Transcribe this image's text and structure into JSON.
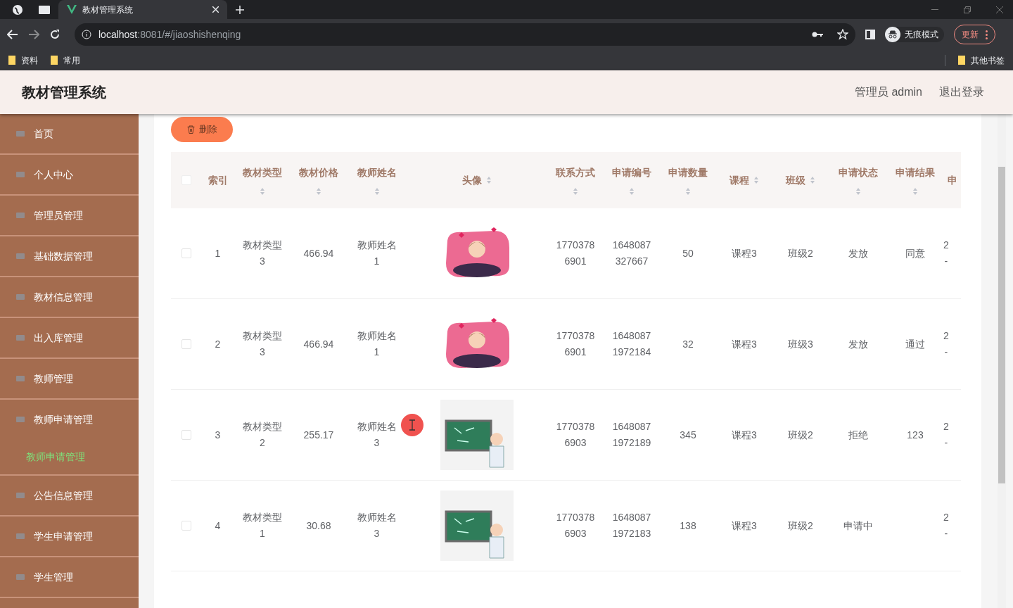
{
  "browser": {
    "tabs": [
      {
        "title": "教材管理系统",
        "selected": true
      }
    ],
    "url_host": "localhost",
    "url_path": ":8081/#/jiaoshishenqing",
    "profile": "无痕模式",
    "update_button": "更新",
    "bookmarks": [
      "资料",
      "常用"
    ],
    "other_bookmarks": "其他书签"
  },
  "header": {
    "title": "教材管理系统",
    "user": "管理员 admin",
    "logout": "退出登录"
  },
  "sidebar": {
    "items": [
      {
        "label": "首页"
      },
      {
        "label": "个人中心"
      },
      {
        "label": "管理员管理"
      },
      {
        "label": "基础数据管理"
      },
      {
        "label": "教材信息管理"
      },
      {
        "label": "出入库管理"
      },
      {
        "label": "教师管理"
      },
      {
        "label": "教师申请管理",
        "children": [
          {
            "label": "教师申请管理",
            "selected": true
          }
        ]
      },
      {
        "label": "公告信息管理"
      },
      {
        "label": "学生申请管理"
      },
      {
        "label": "学生管理"
      }
    ]
  },
  "toolbar": {
    "delete_button": "删除"
  },
  "table": {
    "select_all_checked": false,
    "columns": [
      {
        "label": "索引",
        "sortable": false
      },
      {
        "label": "教材类型",
        "sortable": true
      },
      {
        "label": "教材价格",
        "sortable": true
      },
      {
        "label": "教师姓名",
        "sortable": true
      },
      {
        "label": "头像",
        "sortable": true
      },
      {
        "label": "联系方式",
        "sortable": true
      },
      {
        "label": "申请编号",
        "sortable": true
      },
      {
        "label": "申请数量",
        "sortable": true
      },
      {
        "label": "课程",
        "sortable": true
      },
      {
        "label": "班级",
        "sortable": true
      },
      {
        "label": "申请状态",
        "sortable": true
      },
      {
        "label": "申请结果",
        "sortable": true
      },
      {
        "label": "申",
        "sortable": false
      }
    ],
    "rows": [
      {
        "selected": false,
        "cells": [
          "1",
          "教材类型3",
          "466.94",
          "教师姓名1",
          "",
          "17703786901",
          "1648087327667",
          "50",
          "课程3",
          "班级2",
          "发放",
          "同意",
          "2\n-"
        ],
        "avatar": {
          "kind": "hearts"
        }
      },
      {
        "selected": false,
        "cells": [
          "2",
          "教材类型3",
          "466.94",
          "教师姓名1",
          "",
          "17703786901",
          "16480871972184",
          "32",
          "课程3",
          "班级3",
          "发放",
          "通过",
          "2\n-"
        ],
        "avatar": {
          "kind": "hearts"
        }
      },
      {
        "selected": false,
        "cells": [
          "3",
          "教材类型2",
          "255.17",
          "教师姓名3",
          "",
          "17703786903",
          "16480871972189",
          "345",
          "课程3",
          "班级2",
          "拒绝",
          "123",
          "2\n-"
        ],
        "avatar": {
          "kind": "blackboard"
        }
      },
      {
        "selected": false,
        "cells": [
          "4",
          "教材类型1",
          "30.68",
          "教师姓名3",
          "",
          "17703786903",
          "16480871972183",
          "138",
          "课程3",
          "班级2",
          "申请中",
          "",
          "2\n-"
        ],
        "avatar": {
          "kind": "blackboard"
        }
      }
    ]
  }
}
